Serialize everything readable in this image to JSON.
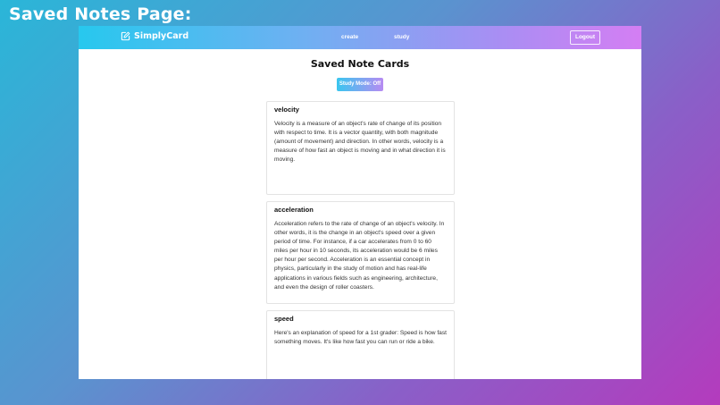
{
  "page_heading": "Saved Notes Page:",
  "navbar": {
    "brand": "SimplyCard",
    "brand_icon": "edit-square-icon",
    "links": [
      {
        "label": "create"
      },
      {
        "label": "study"
      }
    ],
    "logout_label": "Logout"
  },
  "main": {
    "title": "Saved Note Cards",
    "study_mode_label": "Study Mode: Off"
  },
  "cards": [
    {
      "title": "velocity",
      "body": "Velocity is a measure of an object's rate of change of its position with respect to time. It is a vector quantity, with both magnitude (amount of movement) and direction. In other words, velocity is a measure of how fast an object is moving and in what direction it is moving."
    },
    {
      "title": "acceleration",
      "body": "Acceleration refers to the rate of change of an object's velocity. In other words, it is the change in an object's speed over a given period of time. For instance, if a car accelerates from 0 to 60 miles per hour in 10 seconds, its acceleration would be 6 miles per hour per second. Acceleration is an essential concept in physics, particularly in the study of motion and has real-life applications in various fields such as engineering, architecture, and even the design of roller coasters."
    },
    {
      "title": "speed",
      "body": "Here's an explanation of speed for a 1st grader: Speed is how fast something moves. It's like how fast you can run or ride a bike."
    }
  ],
  "colors": {
    "nav_gradient_start": "#27c8ee",
    "nav_gradient_end": "#d47ef3",
    "background_start": "#2ab6d8",
    "background_end": "#b43bbd"
  }
}
